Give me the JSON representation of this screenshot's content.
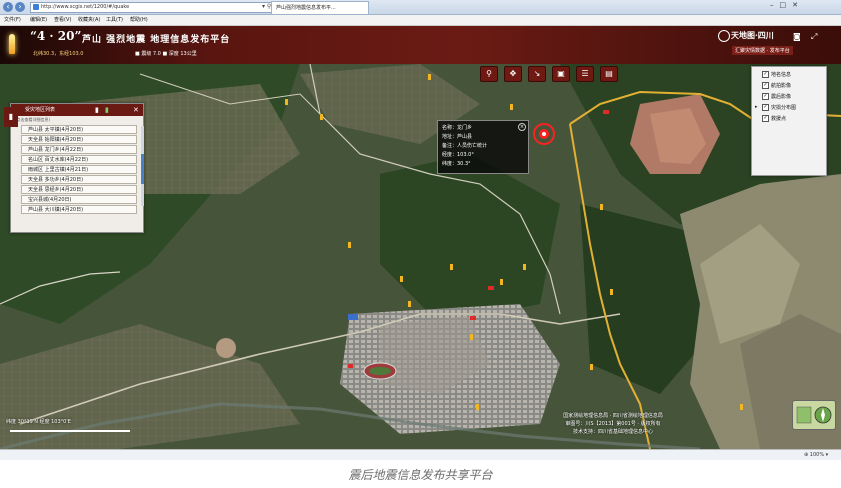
{
  "browser": {
    "address": "http://www.scgis.net/1200/#/quake",
    "addr_ctrls": "▾ ⚲ ⟳ ✕",
    "tab_title": "芦山强烈地震信息发布平...",
    "menu": [
      "文件(F)",
      "编辑(E)",
      "查看(V)",
      "收藏夹(A)",
      "工具(T)",
      "帮助(H)"
    ],
    "zoom": "⊕ 100% ▾"
  },
  "header": {
    "date": "“4 · 20”",
    "title": "芦山  强烈地震  地理信息发布平台",
    "stat1": "北纬30.3，东经103.0",
    "stat2": "■ 震级 7.0  ■ 深度 13公里",
    "logo": "天地图·四川",
    "sub": "汇聚灾情数据 · 发布平台",
    "icons": [
      "camera-icon",
      "fullscreen-icon"
    ]
  },
  "toolbar": {
    "icons": [
      "zoom-in-icon",
      "pan-icon",
      "measure-icon",
      "print-icon",
      "list-icon",
      "layers-icon"
    ]
  },
  "left_panel": {
    "title": "受灾地区列表",
    "subtitle": "(点击查看详细信息)",
    "items": [
      "芦山县 太平镇(4月20日)",
      "天全县 始阳镇(4月20日)",
      "芦山县 龙门乡(4月22日)",
      "名山区 百丈水库(4月22日)",
      "雨城区 上里古镇(4月21日)",
      "天全县 多功乡(4月20日)",
      "天全县 思经乡(4月20日)",
      "宝兴县城(4月20日)",
      "芦山县 大川镇(4月20日)"
    ],
    "scroll_value": 0.45
  },
  "popup": {
    "lines": [
      "名称：龙门乡",
      "地址：芦山县",
      "备注：人员伤亡统计",
      "经度：103.0°",
      "纬度：30.3°"
    ]
  },
  "layer_panel": {
    "items": [
      {
        "label": "地名信息",
        "checked": true
      },
      {
        "label": "航拍影像",
        "checked": true
      },
      {
        "label": "震后影像",
        "checked": true
      },
      {
        "label": "灾损分布图",
        "checked": true
      },
      {
        "label": "救援点",
        "checked": true
      }
    ]
  },
  "map": {
    "coords": "纬度 30°19'N  经度 103°0'E",
    "footer": [
      "国家测绘地理信息局 · 四川省测绘地理信息局",
      "审图号：川S【2013】第001号 · 版权所有",
      "技术支持：四川省基础地理信息中心"
    ]
  },
  "caption": "震后地震信息发布共享平台"
}
